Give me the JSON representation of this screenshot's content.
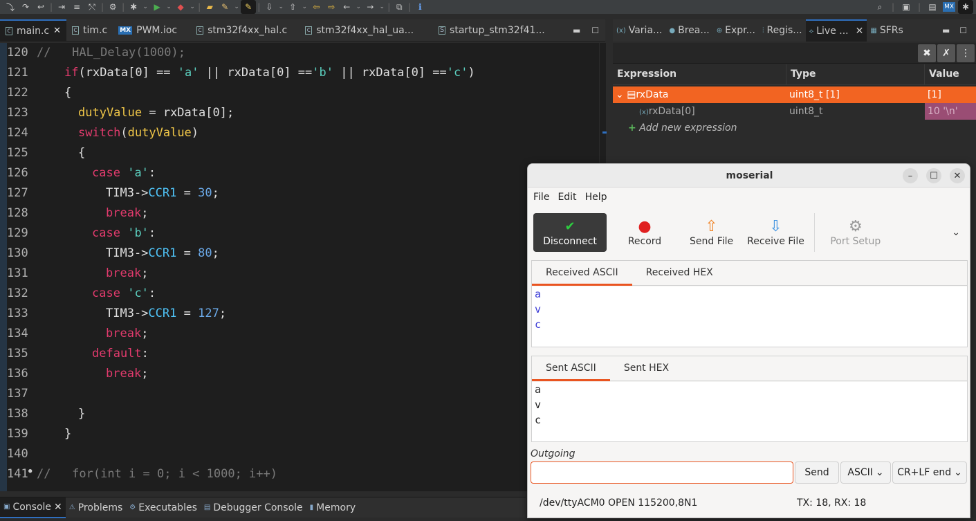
{
  "editor": {
    "tabs": [
      {
        "label": "main.c"
      },
      {
        "label": "tim.c"
      },
      {
        "label": "PWM.ioc"
      },
      {
        "label": "stm32f4xx_hal.c"
      },
      {
        "label": "stm32f4xx_hal_ua..."
      },
      {
        "label": "startup_stm32f41..."
      }
    ],
    "lines": [
      {
        "n": "120"
      },
      {
        "n": "121"
      },
      {
        "n": "122"
      },
      {
        "n": "123"
      },
      {
        "n": "124"
      },
      {
        "n": "125"
      },
      {
        "n": "126"
      },
      {
        "n": "127"
      },
      {
        "n": "128"
      },
      {
        "n": "129"
      },
      {
        "n": "130"
      },
      {
        "n": "131"
      },
      {
        "n": "132"
      },
      {
        "n": "133"
      },
      {
        "n": "134"
      },
      {
        "n": "135"
      },
      {
        "n": "136"
      },
      {
        "n": "137"
      },
      {
        "n": "138"
      },
      {
        "n": "139"
      },
      {
        "n": "140"
      },
      {
        "n": "141"
      }
    ],
    "code": {
      "l120": "//   HAL_Delay(1000);",
      "l121_if": "if",
      "l121_rest1": "(rxData[0] == ",
      "l121_a": "'a'",
      "l121_rest2": " || rxData[0] ==",
      "l121_b": "'b'",
      "l121_rest3": " || rxData[0] ==",
      "l121_c": "'c'",
      "l121_end": ")",
      "l122": "{",
      "l123_var": "dutyValue",
      "l123_rest": " = rxData[0];",
      "l124_sw": "switch",
      "l124_p1": "(",
      "l124_var": "dutyValue",
      "l124_p2": ")",
      "l125": "{",
      "case": "case",
      "colon": ":",
      "l126_val": "'a'",
      "tim": "TIM3->",
      "ccr": "CCR1",
      "eq": " = ",
      "semi": ";",
      "l127_num": "30",
      "brk": "break",
      "l129_val": "'b'",
      "l130_num": "80",
      "l132_val": "'c'",
      "l133_num": "127",
      "l135": "default",
      "l138": "}",
      "l139": "}",
      "l141": "//   for(int i = 0; i < 1000; i++)"
    }
  },
  "right_panel": {
    "tabs": [
      "Varia...",
      "Brea...",
      "Expr...",
      "Regis...",
      "Live ...",
      "SFRs"
    ],
    "columns": [
      "Expression",
      "Type",
      "Value"
    ],
    "rows": [
      {
        "expr": "rxData",
        "type": "uint8_t [1]",
        "value": "[1]"
      },
      {
        "expr": "rxData[0]",
        "type": "uint8_t",
        "value": "10 '\\n'"
      }
    ],
    "add_label": "Add new expression"
  },
  "bottom": {
    "tabs": [
      "Console",
      "Problems",
      "Executables",
      "Debugger Console",
      "Memory"
    ]
  },
  "moserial": {
    "title": "moserial",
    "menu": [
      "File",
      "Edit",
      "Help"
    ],
    "tools": {
      "disconnect": "Disconnect",
      "record": "Record",
      "send_file": "Send File",
      "receive_file": "Receive File",
      "port_setup": "Port Setup"
    },
    "rx_tabs": [
      "Received ASCII",
      "Received HEX"
    ],
    "rx_lines": [
      "a",
      "v",
      "c"
    ],
    "tx_tabs": [
      "Sent ASCII",
      "Sent HEX"
    ],
    "tx_lines": [
      "a",
      "v",
      "c"
    ],
    "outgoing_label": "Outgoing",
    "send": "Send",
    "mode": "ASCII",
    "ending": "CR+LF end",
    "status_port": "/dev/ttyACM0 OPEN 115200,8N1",
    "status_counts": "TX: 18, RX: 18"
  }
}
